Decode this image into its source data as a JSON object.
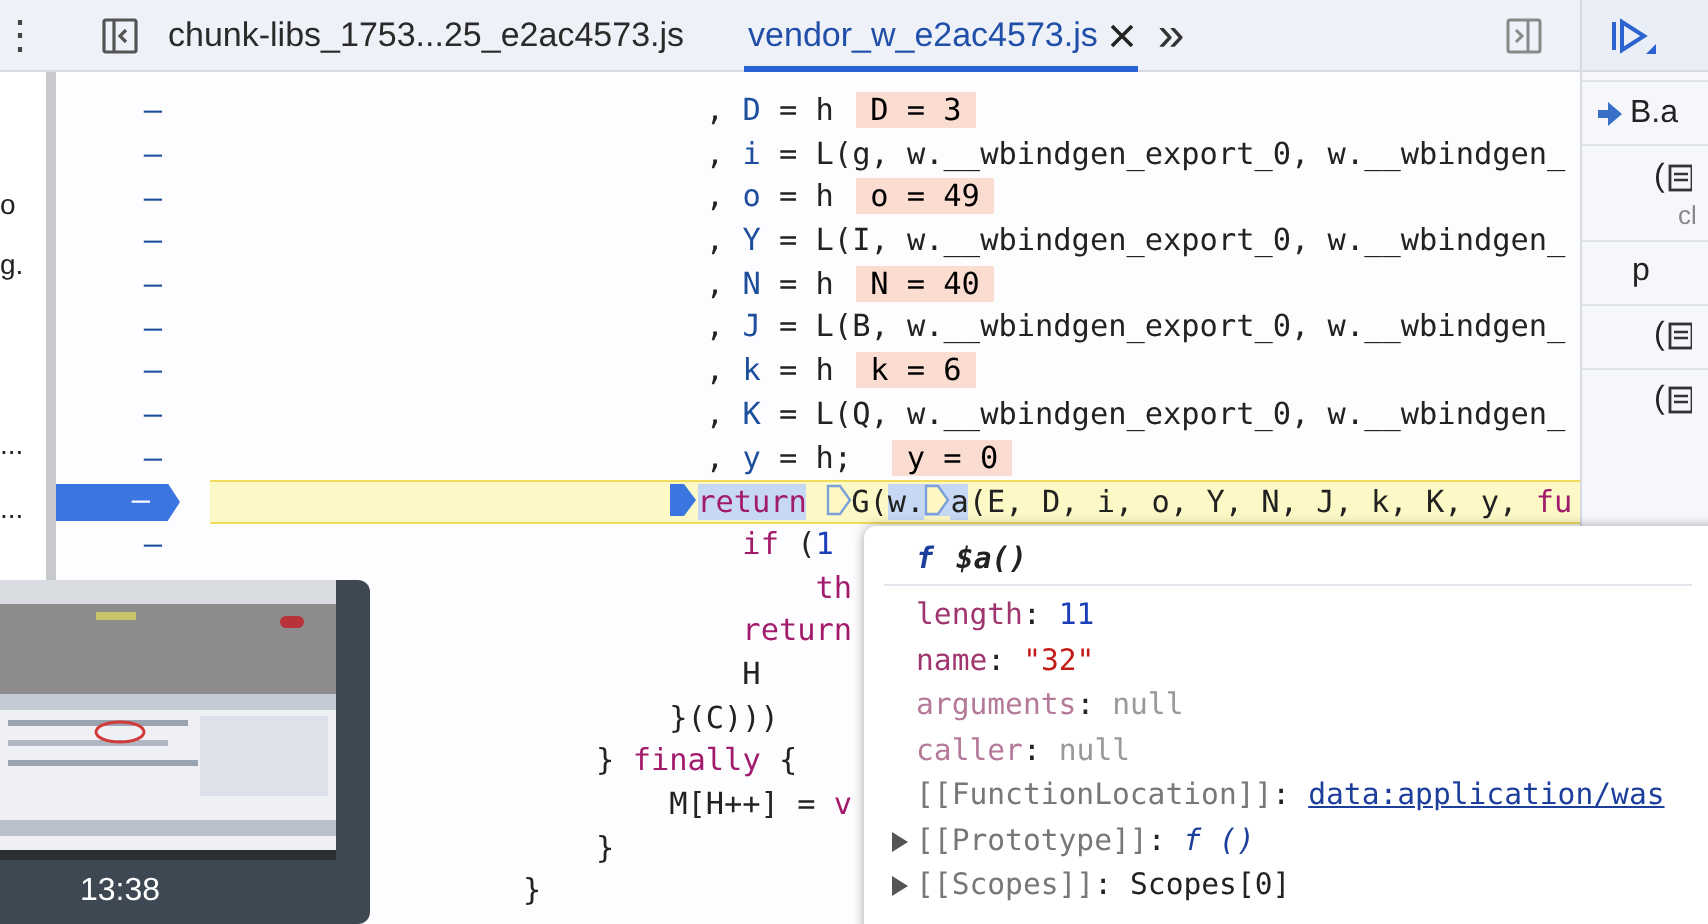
{
  "toolbar": {
    "menu": "⋮",
    "tabs": [
      {
        "label": "chunk-libs_1753...25_e2ac4573.js",
        "selected": false,
        "closable": false
      },
      {
        "label": "vendor_w_e2ac4573.js",
        "selected": true,
        "closable": true
      }
    ],
    "more": "»"
  },
  "left_panel": {
    "items": [
      {
        "text": "o"
      },
      {
        "text": "g."
      },
      {
        "text": "..."
      },
      {
        "text": "..."
      }
    ]
  },
  "code": {
    "lines": [
      {
        "gutter": "–",
        "current": false,
        "segments": [
          {
            "kind": "plain",
            "text": "                           , "
          },
          {
            "kind": "name",
            "text": "D"
          },
          {
            "kind": "plain",
            "text": " = h "
          },
          {
            "kind": "value",
            "text": "D = 3"
          }
        ]
      },
      {
        "gutter": "–",
        "current": false,
        "segments": [
          {
            "kind": "plain",
            "text": "                           , "
          },
          {
            "kind": "name",
            "text": "i"
          },
          {
            "kind": "plain",
            "text": " = L(g, w.__wbindgen_export_0, w.__wbindgen_"
          }
        ]
      },
      {
        "gutter": "–",
        "current": false,
        "segments": [
          {
            "kind": "plain",
            "text": "                           , "
          },
          {
            "kind": "name",
            "text": "o"
          },
          {
            "kind": "plain",
            "text": " = h "
          },
          {
            "kind": "value",
            "text": "o = 49"
          }
        ]
      },
      {
        "gutter": "–",
        "current": false,
        "segments": [
          {
            "kind": "plain",
            "text": "                           , "
          },
          {
            "kind": "name",
            "text": "Y"
          },
          {
            "kind": "plain",
            "text": " = L(I, w.__wbindgen_export_0, w.__wbindgen_"
          }
        ]
      },
      {
        "gutter": "–",
        "current": false,
        "segments": [
          {
            "kind": "plain",
            "text": "                           , "
          },
          {
            "kind": "name",
            "text": "N"
          },
          {
            "kind": "plain",
            "text": " = h "
          },
          {
            "kind": "value",
            "text": "N = 40"
          }
        ]
      },
      {
        "gutter": "–",
        "current": false,
        "segments": [
          {
            "kind": "plain",
            "text": "                           , "
          },
          {
            "kind": "name",
            "text": "J"
          },
          {
            "kind": "plain",
            "text": " = L(B, w.__wbindgen_export_0, w.__wbindgen_"
          }
        ]
      },
      {
        "gutter": "–",
        "current": false,
        "segments": [
          {
            "kind": "plain",
            "text": "                           , "
          },
          {
            "kind": "name",
            "text": "k"
          },
          {
            "kind": "plain",
            "text": " = h "
          },
          {
            "kind": "value",
            "text": "k = 6"
          }
        ]
      },
      {
        "gutter": "–",
        "current": false,
        "segments": [
          {
            "kind": "plain",
            "text": "                           , "
          },
          {
            "kind": "name",
            "text": "K"
          },
          {
            "kind": "plain",
            "text": " = L(Q, w.__wbindgen_export_0, w.__wbindgen_"
          }
        ]
      },
      {
        "gutter": "–",
        "current": false,
        "segments": [
          {
            "kind": "plain",
            "text": "                           , "
          },
          {
            "kind": "name",
            "text": "y"
          },
          {
            "kind": "plain",
            "text": " = h;  "
          },
          {
            "kind": "value",
            "text": "y = 0"
          }
        ]
      },
      {
        "gutter": "–",
        "current": true,
        "segments": [
          {
            "kind": "keyword",
            "text": "                         return",
            "selected": true,
            "paused": true
          },
          {
            "kind": "plain",
            "text": " G(",
            "selected": false,
            "breakpoint": true
          },
          {
            "kind": "plain",
            "text": "w.",
            "selected": true
          },
          {
            "kind": "plain",
            "text": "a",
            "selected": true,
            "breakpoint": true
          },
          {
            "kind": "plain",
            "text": "(E, D, i, o, Y, N, J, k, K, y, "
          },
          {
            "kind": "keyword",
            "text": "fu"
          }
        ]
      },
      {
        "gutter": "–",
        "current": false,
        "segments": [
          {
            "kind": "keyword",
            "text": "                             if"
          },
          {
            "kind": "plain",
            "text": " ("
          },
          {
            "kind": "number",
            "text": "1"
          }
        ]
      },
      {
        "current": false,
        "segments": [
          {
            "kind": "keyword",
            "text": "                                 th"
          }
        ]
      },
      {
        "current": false,
        "segments": [
          {
            "kind": "keyword",
            "text": "                             return"
          }
        ]
      },
      {
        "current": false,
        "segments": [
          {
            "kind": "plain",
            "text": "                             H"
          }
        ]
      },
      {
        "current": false,
        "segments": [
          {
            "kind": "plain",
            "text": "                         }(C)))"
          }
        ]
      },
      {
        "current": false,
        "segments": [
          {
            "kind": "plain",
            "text": "                     } "
          },
          {
            "kind": "keyword",
            "text": "finally"
          },
          {
            "kind": "plain",
            "text": " {"
          }
        ]
      },
      {
        "current": false,
        "segments": [
          {
            "kind": "plain",
            "text": "                         M[H++] = "
          },
          {
            "kind": "keyword",
            "text": "v"
          }
        ]
      },
      {
        "current": false,
        "segments": [
          {
            "kind": "plain",
            "text": "                     }"
          }
        ]
      },
      {
        "current": false,
        "segments": [
          {
            "kind": "plain",
            "text": "                 }"
          }
        ]
      }
    ]
  },
  "call_stack": {
    "items": [
      {
        "kind": "frame",
        "text": "B.a",
        "selected": true
      },
      {
        "kind": "scope",
        "text": "("
      },
      {
        "kind": "sub",
        "text": "cl"
      },
      {
        "kind": "frame",
        "text": "p",
        "selected": false
      },
      {
        "kind": "scope",
        "text": "("
      },
      {
        "kind": "scope",
        "text": "("
      }
    ]
  },
  "popup": {
    "title_prefix": "f",
    "title": "$a()",
    "properties": [
      {
        "key": "length",
        "separator": ":",
        "kind": "own",
        "value": "11",
        "color": "#1a3fb8",
        "expandable": false
      },
      {
        "key": "name",
        "separator": ":",
        "kind": "own",
        "value": "\"32\"",
        "color": "#c41a16",
        "expandable": false
      },
      {
        "key": "arguments",
        "separator": ":",
        "kind": "hidden",
        "value": "null",
        "color": "#999999",
        "expandable": false
      },
      {
        "key": "caller",
        "separator": ":",
        "kind": "hidden",
        "value": "null",
        "color": "#999999",
        "expandable": false
      },
      {
        "key": "[[FunctionLocation]]",
        "separator": ":",
        "kind": "internal",
        "value": "data:application/was",
        "color": "#1d3f9c",
        "link": true,
        "expandable": false
      },
      {
        "key": "[[Prototype]]",
        "separator": ":",
        "kind": "internal",
        "value": "f ()",
        "color": "#1d3f9c",
        "italic": true,
        "expandable": true
      },
      {
        "key": "[[Scopes]]",
        "separator": ":",
        "kind": "internal",
        "value": "Scopes[0]",
        "color": "#222222",
        "expandable": true
      }
    ]
  },
  "video": {
    "time": "13:38"
  }
}
